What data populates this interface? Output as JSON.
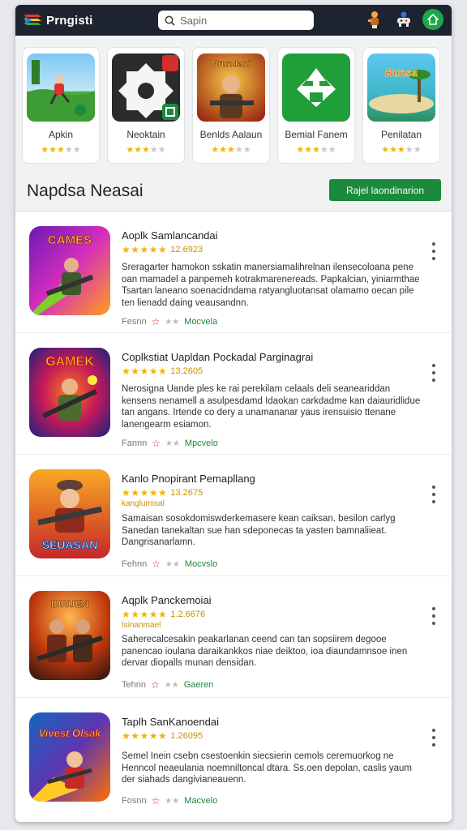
{
  "app": {
    "title": "Prngisti"
  },
  "search": {
    "placeholder": "Sapin"
  },
  "featured": [
    {
      "name": "Apkin",
      "stars": 3
    },
    {
      "name": "Neoktain",
      "stars": 3
    },
    {
      "name": "Benlds Aalaun",
      "stars": 3
    },
    {
      "name": "Bemial Fanem",
      "stars": 3
    },
    {
      "name": "Penilatan",
      "stars": 3
    }
  ],
  "featured_icon_text": {
    "item3": "Nrundani",
    "item5": "Bunsa"
  },
  "section": {
    "title": "Napdsa Neasai",
    "button_label": "Rajel laondinarion"
  },
  "list": [
    {
      "title": "Aoplk Samlancandai",
      "score": "12.6923",
      "sub": "",
      "icon_text": "CAMES",
      "desc": "Sreragarter hamokon sskatin manersiamalihrelnan ilensecoloana pene oan mamadel a panpemeh kotrakmarenereads. Papkalcian, yiniarmthae Tsartan laneano soenacidndama ratyangluotansat olamamo oecan pile ten lienadd daing veausandnn.",
      "meta_label": "Fesnn",
      "tag": "Mocvela"
    },
    {
      "title": "Coplkstiat Uapldan Pockadal Parginagrai",
      "score": "13.2605",
      "sub": "",
      "icon_text": "GAMEK",
      "desc": "Nerosigna Uande ples ke rai perekilam celaals deli seaneariddan kensens nenamell a asulpesdamd Idaokan carkdadme kan daiauridlidue tan angans. Irtende co dery a unamananar yaus irensuisio ttenane lanengearm esiamon.",
      "meta_label": "Fannn",
      "tag": "Mpcvelo"
    },
    {
      "title": "Kanlo Pnopirant Pemapllang",
      "score": "13.2675",
      "sub": "kanglumisal",
      "icon_text": "SEUASAN",
      "desc": "Samaisan sosokdomiswderkemasere kean caiksan. besilon carlyg Sanedan tanekaltan sue han sdeponecas ta yasten bamnaliieat. Dangrisanarlamn.",
      "meta_label": "Fehnn",
      "tag": "Mocvslo"
    },
    {
      "title": "Aqplk Panckemoiai",
      "score": "1.2.6676",
      "sub": "Isinanmael",
      "icon_text": "IDRUEN",
      "desc": "Saherecalcesakin peakarlanan ceend can tan sopsiirem degooe panencao ioulana daraikankkos niae deiktoo, ioa diaundamnsoe inen dervar diopalls munan densidan.",
      "meta_label": "Tehnn",
      "tag": "Gaeren"
    },
    {
      "title": "Taplh SanKanoendai",
      "score": "1.26095",
      "sub": "",
      "icon_text": "Vivest Olsak",
      "desc": "Semel Inein csebn csestoenkin siecsierin cemols ceremuorkog ne Henncol neaeulania noemniltoncal dtara. Ss.oen depolan, caslis yaum der siahads dangivianeauenn.",
      "meta_label": "Fosnn",
      "tag": "Macvelo"
    }
  ],
  "colors": {
    "topbar": "#1d2430",
    "accent_green": "#1c8a3c",
    "star": "#f0b400"
  }
}
